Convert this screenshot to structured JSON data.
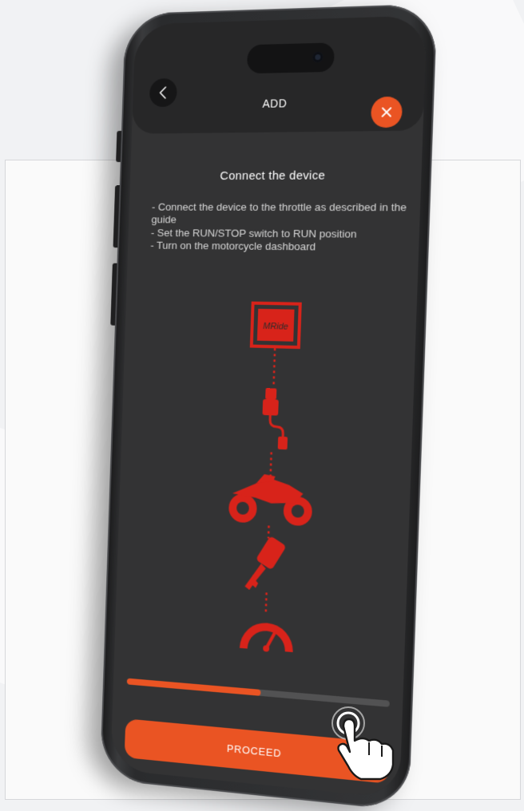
{
  "app": {
    "header": {
      "title": "ADD",
      "back_icon": "chevron-left-icon",
      "close_icon": "close-icon"
    },
    "content": {
      "heading": "Connect the device",
      "instructions": [
        "- Connect the device to the throttle as described in the guide",
        "- Set the RUN/STOP switch to RUN position",
        "- Turn on the motorcycle dashboard"
      ]
    },
    "diagram": {
      "device_label": "MRide",
      "steps": [
        "mride-device-icon",
        "usb-cable-icon",
        "motorcycle-icon",
        "ignition-key-icon",
        "dashboard-gauge-icon"
      ]
    },
    "progress": {
      "value": 0.52
    },
    "footer": {
      "proceed_label": "PROCEED"
    }
  },
  "colors": {
    "accent": "#ea5423",
    "screen_bg": "#333334",
    "header_bg": "#272728",
    "diagram_red": "#d8231a"
  }
}
